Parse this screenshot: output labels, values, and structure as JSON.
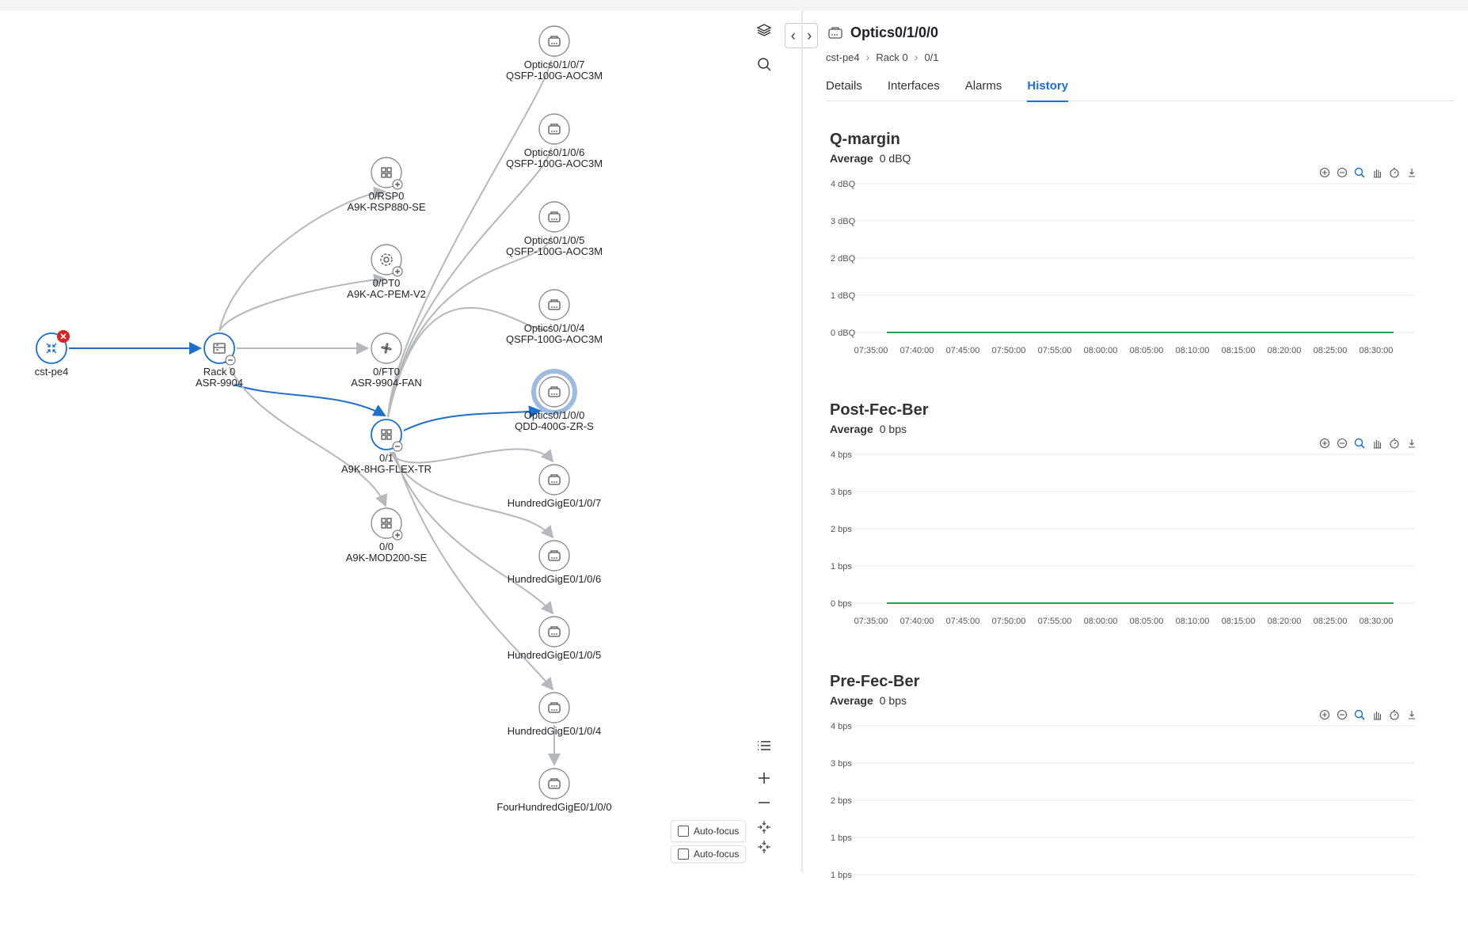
{
  "graph": {
    "nodes": [
      {
        "id": "cst-pe4",
        "label1": "cst-pe4",
        "label2": "",
        "icon": "compress-icon",
        "selected": true,
        "error": true
      },
      {
        "id": "rack0",
        "label1": "Rack 0",
        "label2": "ASR-9904",
        "icon": "chassis-icon",
        "selected": true
      },
      {
        "id": "rsp0",
        "label1": "0/RSP0",
        "label2": "A9K-RSP880-SE",
        "icon": "module-icon"
      },
      {
        "id": "pt0",
        "label1": "0/PT0",
        "label2": "A9K-AC-PEM-V2",
        "icon": "gear-icon"
      },
      {
        "id": "ft0",
        "label1": "0/FT0",
        "label2": "ASR-9904-FAN",
        "icon": "fan-icon"
      },
      {
        "id": "slot01",
        "label1": "0/1",
        "label2": "A9K-8HG-FLEX-TR",
        "icon": "module-icon",
        "selected": true
      },
      {
        "id": "slot00",
        "label1": "0/0",
        "label2": "A9K-MOD200-SE",
        "icon": "module-icon"
      },
      {
        "id": "opt7",
        "label1": "Optics0/1/0/7",
        "label2": "QSFP-100G-AOC3M",
        "icon": "port-icon"
      },
      {
        "id": "opt6",
        "label1": "Optics0/1/0/6",
        "label2": "QSFP-100G-AOC3M",
        "icon": "port-icon"
      },
      {
        "id": "opt5",
        "label1": "Optics0/1/0/5",
        "label2": "QSFP-100G-AOC3M",
        "icon": "port-icon"
      },
      {
        "id": "opt4",
        "label1": "Optics0/1/0/4",
        "label2": "QSFP-100G-AOC3M",
        "icon": "port-icon"
      },
      {
        "id": "opt0",
        "label1": "Optics0/1/0/0",
        "label2": "QDD-400G-ZR-S",
        "icon": "port-icon",
        "highlight": true
      },
      {
        "id": "hg7",
        "label1": "HundredGigE0/1/0/7",
        "label2": "",
        "icon": "port-icon"
      },
      {
        "id": "hg6",
        "label1": "HundredGigE0/1/0/6",
        "label2": "",
        "icon": "port-icon"
      },
      {
        "id": "hg5",
        "label1": "HundredGigE0/1/0/5",
        "label2": "",
        "icon": "port-icon"
      },
      {
        "id": "hg4",
        "label1": "HundredGigE0/1/0/4",
        "label2": "",
        "icon": "port-icon"
      },
      {
        "id": "fhg0",
        "label1": "FourHundredGigE0/1/0/0",
        "label2": "",
        "icon": "port-icon"
      }
    ],
    "autofocus_label": "Auto-focus",
    "autofocus_label_2": "Auto-focus"
  },
  "panel": {
    "title": "Optics0/1/0/0",
    "breadcrumbs": [
      "cst-pe4",
      "Rack 0",
      "0/1"
    ],
    "tabs": [
      "Details",
      "Interfaces",
      "Alarms",
      "History"
    ],
    "active_tab": "History",
    "charts": [
      {
        "title": "Q-margin",
        "avg_label": "Average",
        "avg_value": "0 dBQ",
        "y_ticks": [
          "4 dBQ",
          "3 dBQ",
          "2 dBQ",
          "1 dBQ",
          "0 dBQ"
        ],
        "x_ticks": [
          "07:35:00",
          "07:40:00",
          "07:45:00",
          "07:50:00",
          "07:55:00",
          "08:00:00",
          "08:05:00",
          "08:10:00",
          "08:15:00",
          "08:20:00",
          "08:25:00",
          "08:30:00"
        ]
      },
      {
        "title": "Post-Fec-Ber",
        "avg_label": "Average",
        "avg_value": "0 bps",
        "y_ticks": [
          "4 bps",
          "3 bps",
          "2 bps",
          "1 bps",
          "0 bps"
        ],
        "x_ticks": [
          "07:35:00",
          "07:40:00",
          "07:45:00",
          "07:50:00",
          "07:55:00",
          "08:00:00",
          "08:05:00",
          "08:10:00",
          "08:15:00",
          "08:20:00",
          "08:25:00",
          "08:30:00"
        ]
      },
      {
        "title": "Pre-Fec-Ber",
        "avg_label": "Average",
        "avg_value": "0 bps",
        "y_ticks": [
          "4 bps",
          "3 bps",
          "2 bps",
          "1 bps",
          "1 bps"
        ],
        "x_ticks": []
      }
    ]
  },
  "colors": {
    "accent": "#1d6fc9",
    "series": "#2e9e4f",
    "error": "#d92323"
  }
}
